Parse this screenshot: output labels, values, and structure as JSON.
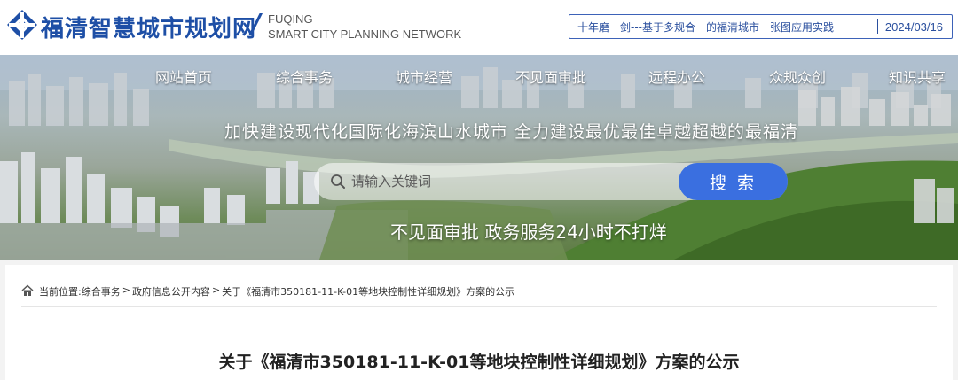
{
  "header": {
    "site_name": "福清智慧城市规划网",
    "slash": "/",
    "site_name_en_line1": "FUQING",
    "site_name_en_line2": "SMART CITY PLANNING NETWORK",
    "notice_text": "十年磨一剑---基于多规合一的福清城市一张图应用实践",
    "notice_date": "2024/03/16",
    "brand_color": "#1e4fa6"
  },
  "nav": {
    "items": [
      {
        "label": "网站首页"
      },
      {
        "label": "综合事务"
      },
      {
        "label": "城市经营"
      },
      {
        "label": "不见面审批"
      },
      {
        "label": "远程办公"
      },
      {
        "label": "众规众创"
      },
      {
        "label": "知识共享"
      }
    ]
  },
  "banner": {
    "slogan_top": "加快建设现代化国际化海滨山水城市  全力建设最优最佳卓越超越的最福清",
    "slogan_bottom": "不见面审批   政务服务24小时不打烊"
  },
  "search": {
    "placeholder": "请输入关键词",
    "button_label": "搜 索",
    "button_color": "#3a6fe0"
  },
  "breadcrumb": {
    "prefix": "当前位置:",
    "items": [
      "综合事务",
      "政府信息公开内容",
      "关于《福清市350181-11-K-01等地块控制性详细规划》方案的公示"
    ],
    "separator": ">"
  },
  "article": {
    "title": "关于《福清市350181-11-K-01等地块控制性详细规划》方案的公示"
  },
  "icons": {
    "logo": "diamond-logo-icon",
    "search": "search-icon",
    "home": "home-icon"
  }
}
